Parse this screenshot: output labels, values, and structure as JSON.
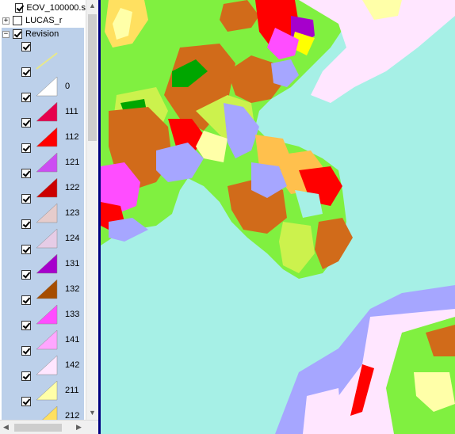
{
  "toc": {
    "layers": [
      {
        "name": "EOV_100000.s",
        "checked": true,
        "expander": "+"
      },
      {
        "name": "LUCAS_r",
        "checked": false,
        "expander": "+"
      },
      {
        "name": "Revision",
        "checked": true,
        "expander": "−"
      }
    ],
    "revision_classes": [
      {
        "code": "",
        "color": "#e8e88a",
        "shape": "line"
      },
      {
        "code": "0",
        "color": "#ffffff"
      },
      {
        "code": "111",
        "color": "#e6004d"
      },
      {
        "code": "112",
        "color": "#ff0000"
      },
      {
        "code": "121",
        "color": "#cc4df2"
      },
      {
        "code": "122",
        "color": "#cc0000"
      },
      {
        "code": "123",
        "color": "#e6cccc"
      },
      {
        "code": "124",
        "color": "#e6cce6"
      },
      {
        "code": "131",
        "color": "#a600cc"
      },
      {
        "code": "132",
        "color": "#a64d00"
      },
      {
        "code": "133",
        "color": "#ff4dff"
      },
      {
        "code": "141",
        "color": "#ffa6ff"
      },
      {
        "code": "142",
        "color": "#ffe6ff"
      },
      {
        "code": "211",
        "color": "#ffffa8"
      },
      {
        "code": "212",
        "color": "#ffe060"
      }
    ]
  },
  "scrollbars": {
    "up_arrow": "▲",
    "down_arrow": "▼",
    "left_arrow": "◀",
    "right_arrow": "▶"
  },
  "map": {
    "sea_color": "#a6f0e6",
    "colors": {
      "green": "#80f040",
      "light_green": "#ccf24d",
      "orange": "#d16b1a",
      "lavender": "#a6a6ff",
      "pink": "#ffe6ff",
      "tan": "#ffc04d",
      "red": "#ff0000",
      "yellow": "#ffffa8",
      "dark_green": "#00a600",
      "magenta": "#ff4dff",
      "purple": "#a600cc"
    }
  }
}
